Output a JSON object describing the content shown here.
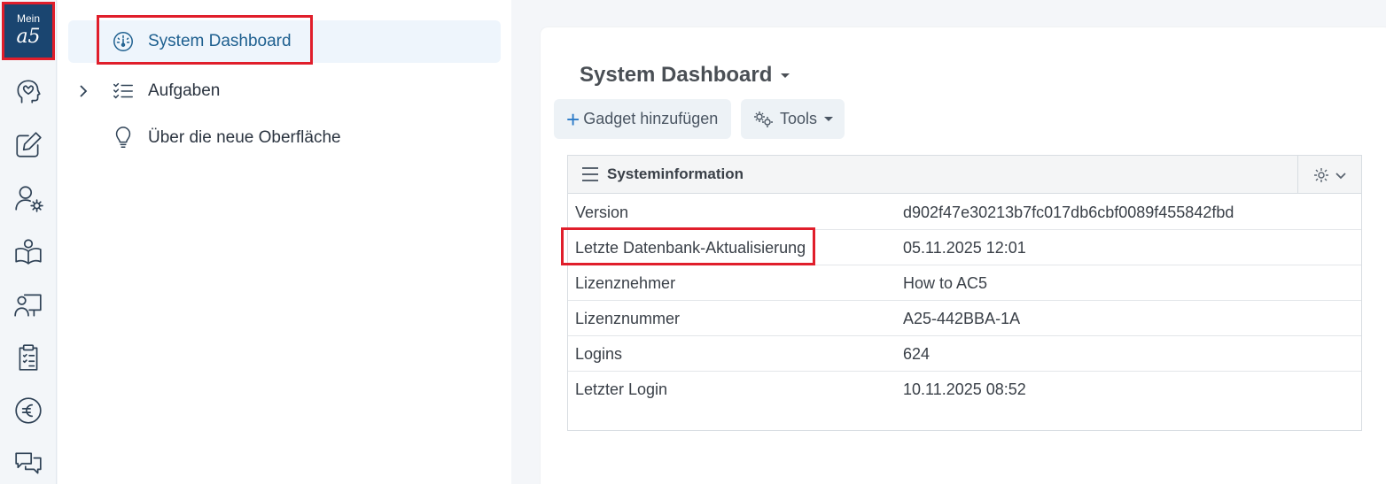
{
  "logo": {
    "line1": "Mein",
    "line2": "a5"
  },
  "rail_icons": [
    "head-heart-icon",
    "edit-icon",
    "user-settings-icon",
    "book-user-icon",
    "presentation-user-icon",
    "clipboard-list-icon",
    "euro-icon",
    "chat-icon"
  ],
  "sidebar": {
    "items": [
      {
        "label": "System Dashboard",
        "icon": "dashboard-gauge-icon",
        "active": true
      },
      {
        "label": "Aufgaben",
        "icon": "checklist-icon",
        "expandable": true
      },
      {
        "label": "Über die neue Oberfläche",
        "icon": "lightbulb-icon"
      }
    ]
  },
  "main": {
    "title": "System Dashboard",
    "toolbar": {
      "add_label": "Gadget hinzufügen",
      "tools_label": "Tools"
    },
    "gadget": {
      "title": "Systeminformation",
      "rows": [
        {
          "key": "Version",
          "value": "d902f47e30213b7fc017db6cbf0089f455842fbd"
        },
        {
          "key": "Letzte Datenbank-Aktualisierung",
          "value": "05.11.2025 12:01"
        },
        {
          "key": "Lizenznehmer",
          "value": "How to AC5"
        },
        {
          "key": "Lizenznummer",
          "value": "A25-442BBA-1A"
        },
        {
          "key": "Logins",
          "value": "624"
        },
        {
          "key": "Letzter Login",
          "value": "10.11.2025 08:52"
        }
      ]
    }
  },
  "colors": {
    "accent": "#1d5f8f",
    "highlight": "#e01e2b",
    "logo_bg": "#1a4570"
  }
}
